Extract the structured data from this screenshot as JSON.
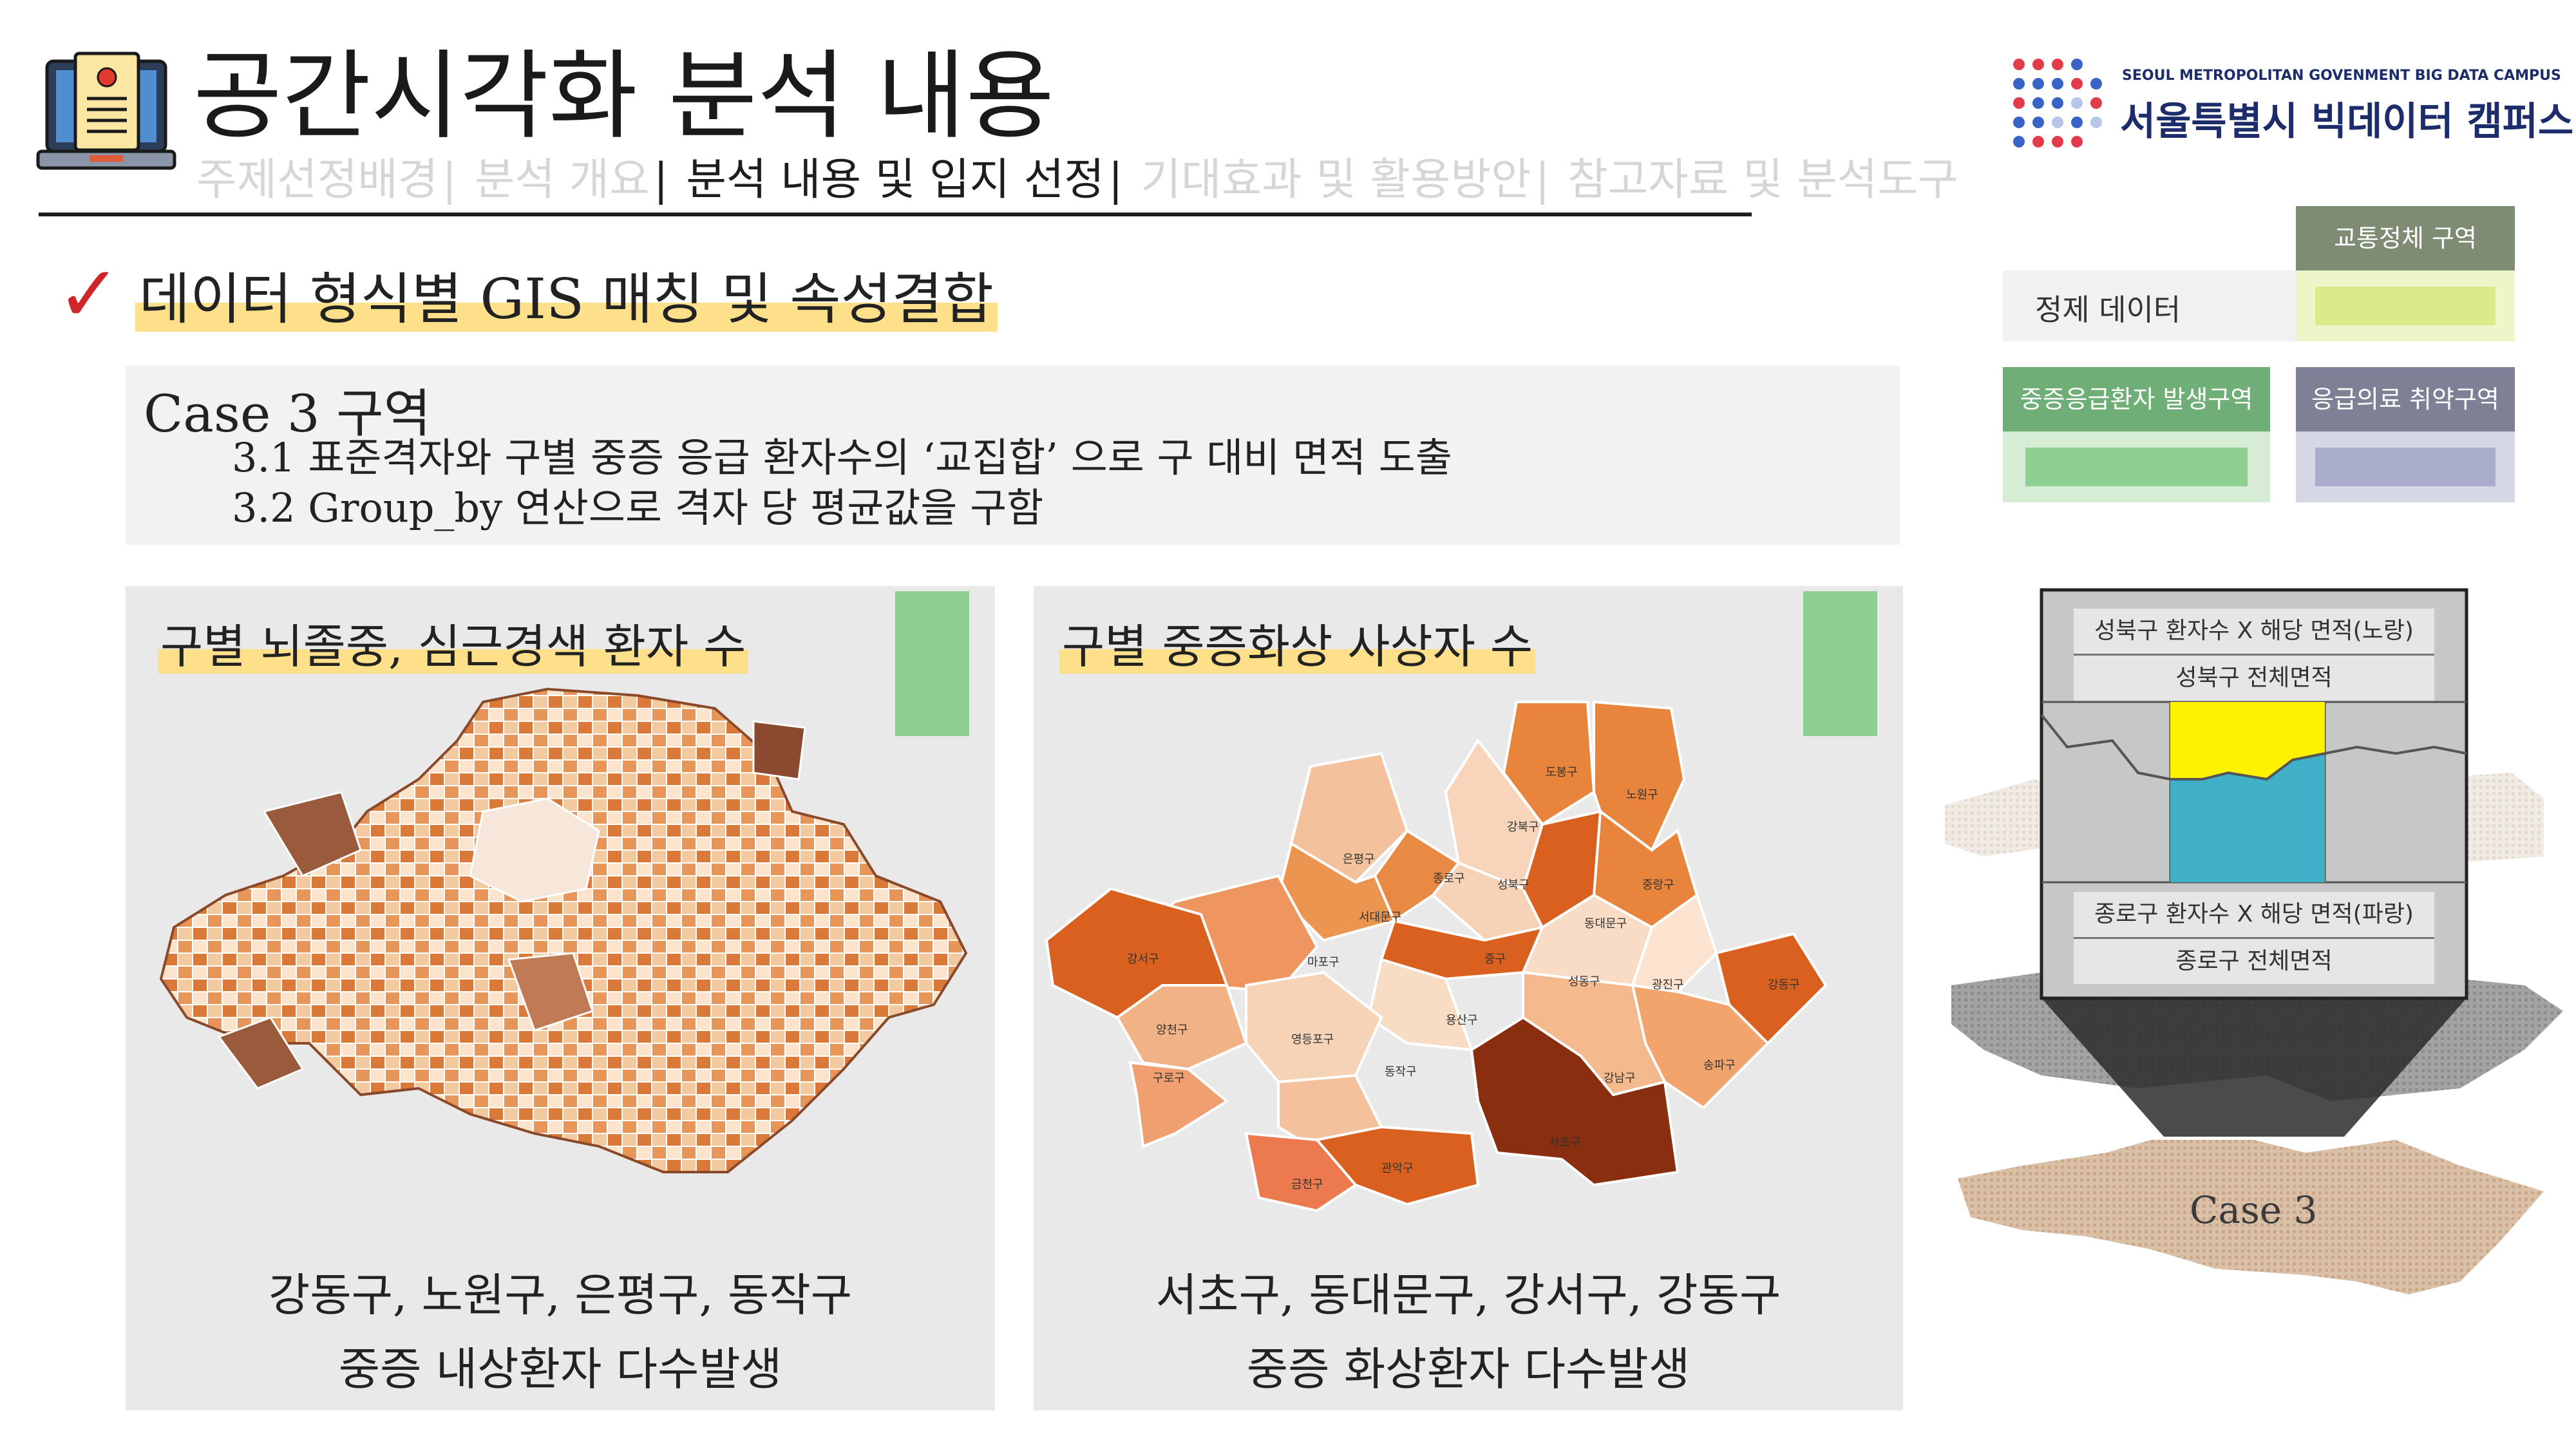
{
  "header": {
    "title": "공간시각화 분석 내용",
    "nav": [
      {
        "label": "주제선정배경",
        "current": false
      },
      {
        "label": "분석 개요",
        "current": false
      },
      {
        "label": "분석 내용 및 입지 선정",
        "current": true
      },
      {
        "label": "기대효과 및 활용방안",
        "current": false
      },
      {
        "label": "참고자료 및 분석도구",
        "current": false
      }
    ],
    "separator": "|",
    "logo_en": "SEOUL METROPOLITAN GOVENMENT BIG DATA CAMPUS",
    "logo_ko": "서울특별시 빅데이터 캠퍼스"
  },
  "section": {
    "check": "✓",
    "heading": "데이터 형식별 GIS 매칭 및 속성결합"
  },
  "case": {
    "title": "Case 3 구역",
    "lines": [
      "3.1  표준격자와 구별 중증 응급 환자수의 ‘교집합’ 으로 구 대비 면적 도출",
      "3.2  Group_by 연산으로 격자 당 평균값을 구함"
    ]
  },
  "panels": [
    {
      "title": "구별 뇌졸중, 심근경색 환자 수",
      "caption_line1": "강동구, 노원구, 은평구, 동작구",
      "caption_line2": "중증 내상환자 다수발생"
    },
    {
      "title": "구별 중증화상 사상자 수",
      "caption_line1": "서초구, 동대문구, 강서구, 강동구",
      "caption_line2": "중증 화상환자 다수발생",
      "districts": [
        "도봉구",
        "노원구",
        "강북구",
        "은평구",
        "성북구",
        "종로구",
        "중랑구",
        "서대문구",
        "동대문구",
        "마포구",
        "강서구",
        "중구",
        "성동구",
        "광진구",
        "강동구",
        "용산구",
        "양천구",
        "영등포구",
        "구로구",
        "동작구",
        "강남구",
        "송파구",
        "서초구",
        "관악구",
        "금천구"
      ]
    }
  ],
  "legend": {
    "traffic_header": "교통정체 구역",
    "traffic_label": "정제 데이터",
    "severe_header": "중증응급환자 발생구역",
    "vuln_header": "응급의료 취약구역",
    "colors": {
      "traffic": "#dbeb8a",
      "severe": "#8ecf92",
      "vuln": "#a9accb"
    }
  },
  "diagram": {
    "formula1_top": "성북구 환자수 X 해당 면적(노랑)",
    "formula1_bottom": "성북구 전체면적",
    "formula2_top": "종로구 환자수 X 해당 면적(파랑)",
    "formula2_bottom": "종로구 전체면적",
    "case_label": "Case 3"
  }
}
